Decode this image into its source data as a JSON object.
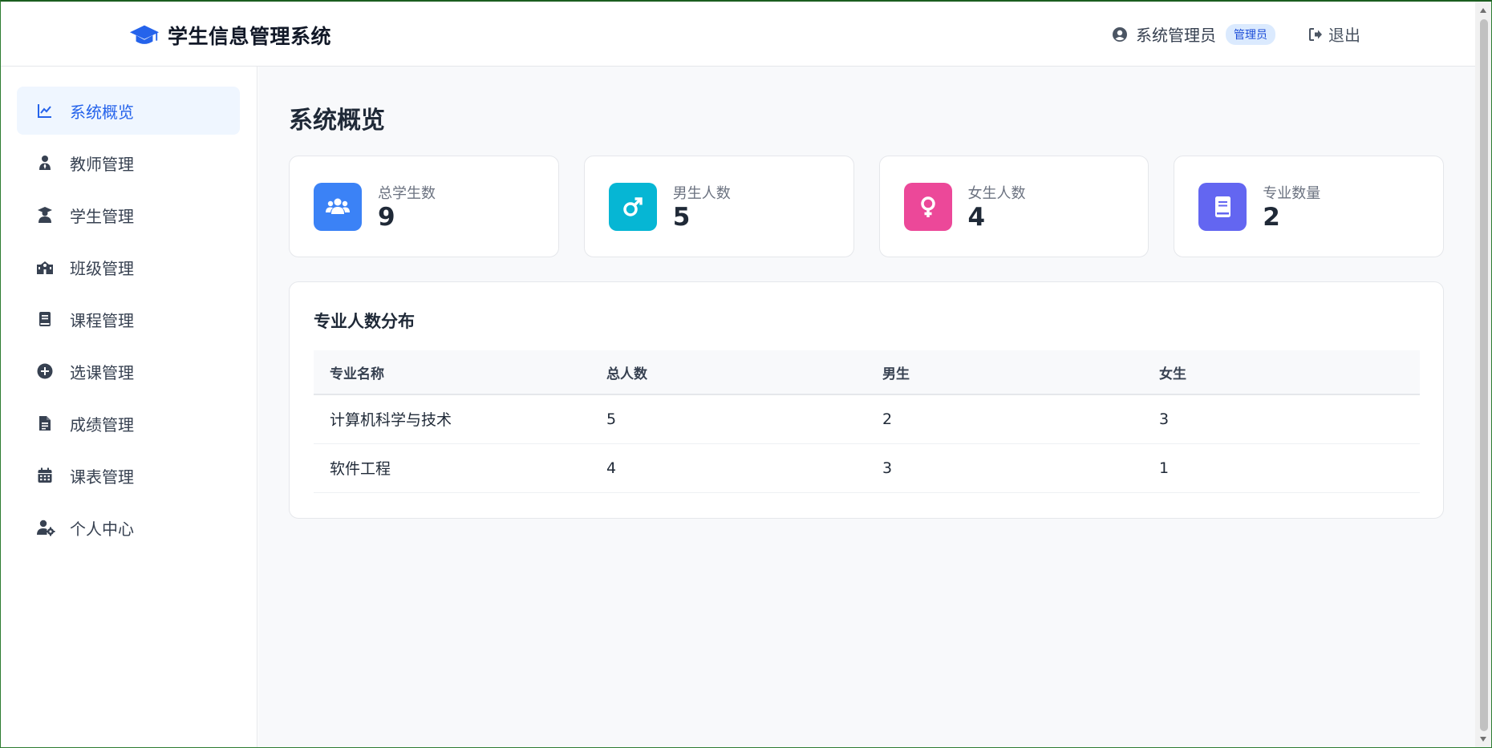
{
  "header": {
    "title": "学生信息管理系统",
    "brand_icon": "graduation-cap-icon",
    "user_name": "系统管理员",
    "role_badge": "管理员",
    "logout_label": "退出"
  },
  "sidebar": {
    "items": [
      {
        "label": "系统概览",
        "icon": "chart-line-icon",
        "active": true
      },
      {
        "label": "教师管理",
        "icon": "teacher-icon",
        "active": false
      },
      {
        "label": "学生管理",
        "icon": "student-icon",
        "active": false
      },
      {
        "label": "班级管理",
        "icon": "school-icon",
        "active": false
      },
      {
        "label": "课程管理",
        "icon": "book-icon",
        "active": false
      },
      {
        "label": "选课管理",
        "icon": "plus-circle-icon",
        "active": false
      },
      {
        "label": "成绩管理",
        "icon": "file-icon",
        "active": false
      },
      {
        "label": "课表管理",
        "icon": "calendar-icon",
        "active": false
      },
      {
        "label": "个人中心",
        "icon": "user-cog-icon",
        "active": false
      }
    ]
  },
  "main": {
    "page_title": "系统概览",
    "stats": [
      {
        "label": "总学生数",
        "value": "9",
        "icon": "users-icon",
        "color": "#3b82f6"
      },
      {
        "label": "男生人数",
        "value": "5",
        "icon": "mars-icon",
        "color": "#06b6d4"
      },
      {
        "label": "女生人数",
        "value": "4",
        "icon": "venus-icon",
        "color": "#ec4899"
      },
      {
        "label": "专业数量",
        "value": "2",
        "icon": "book-icon",
        "color": "#6366f1"
      }
    ],
    "distribution": {
      "title": "专业人数分布",
      "headers": [
        "专业名称",
        "总人数",
        "男生",
        "女生"
      ],
      "rows": [
        [
          "计算机科学与技术",
          "5",
          "2",
          "3"
        ],
        [
          "软件工程",
          "4",
          "3",
          "1"
        ]
      ]
    }
  },
  "colors": {
    "accent": "#2563eb",
    "active_bg": "#eff6ff",
    "badge_bg": "#dbeafe"
  }
}
